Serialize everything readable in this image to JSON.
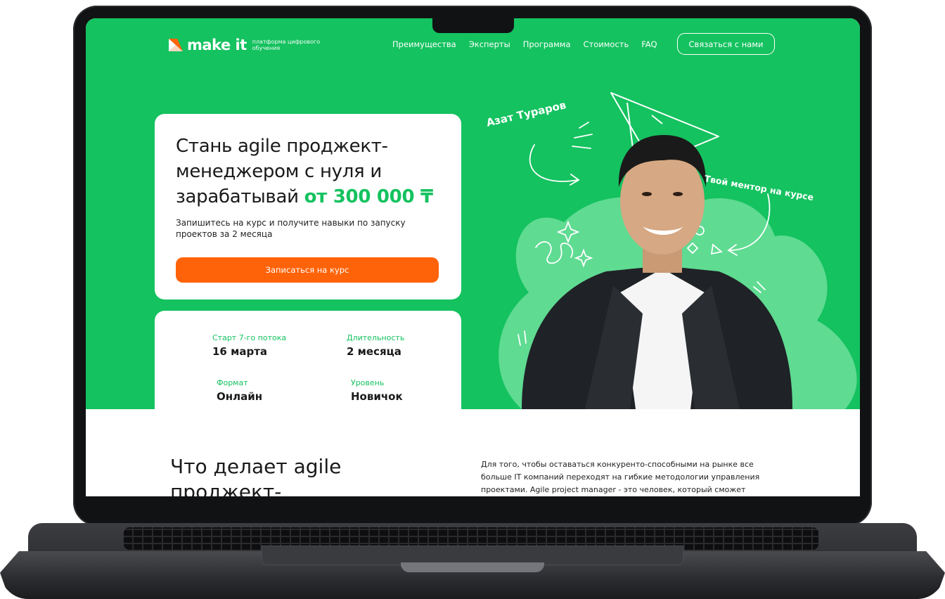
{
  "nav": {
    "logo_text": "make it",
    "logo_tagline": "платформа цифрового обучения",
    "links": [
      "Преимущества",
      "Эксперты",
      "Программа",
      "Стоимость",
      "FAQ"
    ],
    "contact_label": "Связаться с нами"
  },
  "hero": {
    "title_prefix": "Стань agile проджект-менеджером с нуля и зарабатывай ",
    "title_accent": "от 300 000 ₸",
    "subtitle": "Запишитесь на курс и получите навыки по запуску проектов за 2 месяца",
    "cta_label": "Записаться на курс"
  },
  "info": [
    {
      "label": "Старт 7-го потока",
      "value": "16 марта"
    },
    {
      "label": "Длительность",
      "value": "2 месяца"
    },
    {
      "label": "Формат",
      "value": "Онлайн"
    },
    {
      "label": "Уровень",
      "value": "Новичок"
    }
  ],
  "mentor": {
    "name": "Азат Тураров",
    "caption": "Твой ментор на курсе"
  },
  "section2": {
    "title": "Что делает agile проджект-менеджер?",
    "text": "Для того, чтобы оставаться конкуренто-способными на рынке все больше IT компаний переходят на гибкие методологии управления проектами. Agile project manager - это человек, который сможет"
  },
  "colors": {
    "brand_green": "#14c25f",
    "accent_orange": "#ff6309",
    "frame_dark": "#111214"
  }
}
